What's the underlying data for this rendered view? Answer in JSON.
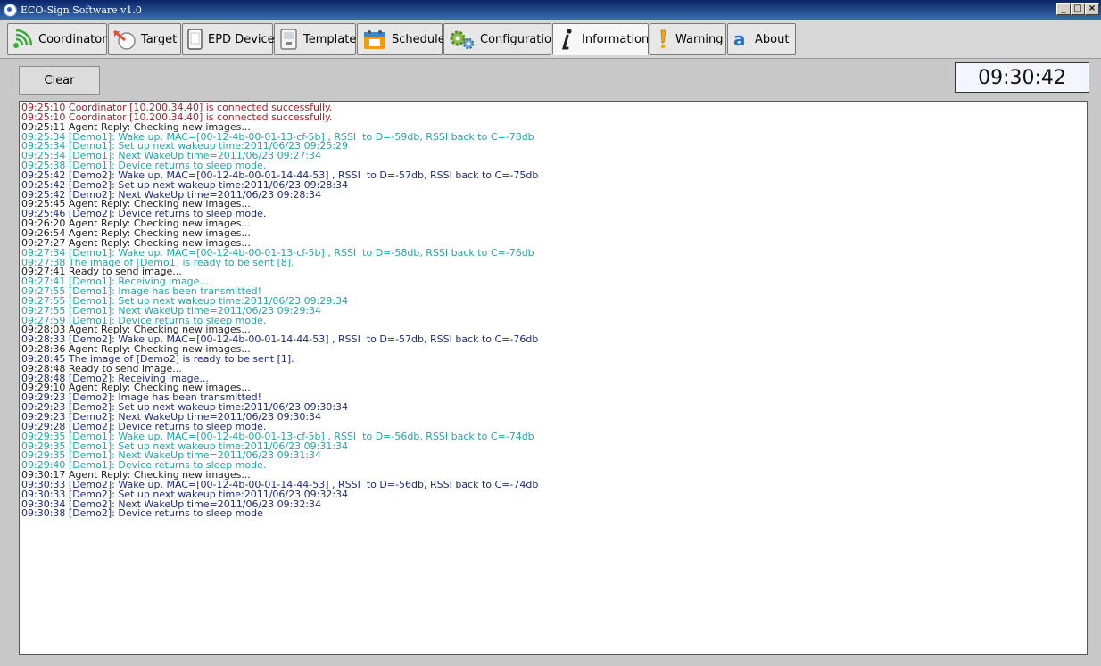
{
  "window": {
    "title": "ECO-Sign Software v1.0",
    "buttons": [
      "_",
      "□",
      "×"
    ]
  },
  "tabs": [
    {
      "label": "Coordinator",
      "icon": "signal-waves-icon"
    },
    {
      "label": "Target",
      "icon": "target-arrow-icon"
    },
    {
      "label": "EPD Device",
      "icon": "device-icon"
    },
    {
      "label": "Template",
      "icon": "template-icon"
    },
    {
      "label": "Schedule",
      "icon": "calendar-icon"
    },
    {
      "label": "Configuration",
      "icon": "gears-icon"
    },
    {
      "label": "Information",
      "icon": "info-icon",
      "active": true
    },
    {
      "label": "Warning",
      "icon": "exclamation-icon"
    },
    {
      "label": "About",
      "icon": "about-a-icon"
    }
  ],
  "toolbar": {
    "clear_label": "Clear",
    "clock": "09:30:42"
  },
  "log": [
    {
      "text": "09:25:10 Coordinator [10.200.34.40] is connected successfully.",
      "color": "red"
    },
    {
      "text": "09:25:10 Coordinator [10.200.34.40] is connected successfully.",
      "color": "red"
    },
    {
      "text": "09:25:11 Agent Reply: Checking new images...",
      "color": "black"
    },
    {
      "text": "09:25:34 [Demo1]: Wake up. MAC=[00-12-4b-00-01-13-cf-5b] , RSSI  to D=-59db, RSSI back to C=-78db",
      "color": "teal"
    },
    {
      "text": "09:25:34 [Demo1]: Set up next wakeup time:2011/06/23 09:25:29",
      "color": "teal"
    },
    {
      "text": "09:25:34 [Demo1]: Next WakeUp time=2011/06/23 09:27:34",
      "color": "teal"
    },
    {
      "text": "09:25:38 [Demo1]: Device returns to sleep mode.",
      "color": "teal"
    },
    {
      "text": "09:25:42 [Demo2]: Wake up. MAC=[00-12-4b-00-01-14-44-53] , RSSI  to D=-57db, RSSI back to C=-75db",
      "color": "navy"
    },
    {
      "text": "09:25:42 [Demo2]: Set up next wakeup time:2011/06/23 09:28:34",
      "color": "navy"
    },
    {
      "text": "09:25:42 [Demo2]: Next WakeUp time=2011/06/23 09:28:34",
      "color": "navy"
    },
    {
      "text": "09:25:45 Agent Reply: Checking new images...",
      "color": "black"
    },
    {
      "text": "09:25:46 [Demo2]: Device returns to sleep mode.",
      "color": "navy"
    },
    {
      "text": "09:26:20 Agent Reply: Checking new images...",
      "color": "black"
    },
    {
      "text": "09:26:54 Agent Reply: Checking new images...",
      "color": "black"
    },
    {
      "text": "09:27:27 Agent Reply: Checking new images...",
      "color": "black"
    },
    {
      "text": "09:27:34 [Demo1]: Wake up. MAC=[00-12-4b-00-01-13-cf-5b] , RSSI  to D=-58db, RSSI back to C=-76db",
      "color": "teal"
    },
    {
      "text": "09:27:38 The image of [Demo1] is ready to be sent [8].",
      "color": "teal"
    },
    {
      "text": "09:27:41 Ready to send image...",
      "color": "black"
    },
    {
      "text": "09:27:41 [Demo1]: Receiving image...",
      "color": "teal"
    },
    {
      "text": "09:27:55 [Demo1]: Image has been transmitted!",
      "color": "teal"
    },
    {
      "text": "09:27:55 [Demo1]: Set up next wakeup time:2011/06/23 09:29:34",
      "color": "teal"
    },
    {
      "text": "09:27:55 [Demo1]: Next WakeUp time=2011/06/23 09:29:34",
      "color": "teal"
    },
    {
      "text": "09:27:59 [Demo1]: Device returns to sleep mode.",
      "color": "teal"
    },
    {
      "text": "09:28:03 Agent Reply: Checking new images...",
      "color": "black"
    },
    {
      "text": "09:28:33 [Demo2]: Wake up. MAC=[00-12-4b-00-01-14-44-53] , RSSI  to D=-57db, RSSI back to C=-76db",
      "color": "navy"
    },
    {
      "text": "09:28:36 Agent Reply: Checking new images...",
      "color": "black"
    },
    {
      "text": "09:28:45 The image of [Demo2] is ready to be sent [1].",
      "color": "navy"
    },
    {
      "text": "09:28:48 Ready to send image...",
      "color": "black"
    },
    {
      "text": "09:28:48 [Demo2]: Receiving image...",
      "color": "navy"
    },
    {
      "text": "09:29:10 Agent Reply: Checking new images...",
      "color": "black"
    },
    {
      "text": "09:29:23 [Demo2]: Image has been transmitted!",
      "color": "navy"
    },
    {
      "text": "09:29:23 [Demo2]: Set up next wakeup time:2011/06/23 09:30:34",
      "color": "navy"
    },
    {
      "text": "09:29:23 [Demo2]: Next WakeUp time=2011/06/23 09:30:34",
      "color": "navy"
    },
    {
      "text": "09:29:28 [Demo2]: Device returns to sleep mode.",
      "color": "navy"
    },
    {
      "text": "09:29:35 [Demo1]: Wake up. MAC=[00-12-4b-00-01-13-cf-5b] , RSSI  to D=-56db, RSSI back to C=-74db",
      "color": "teal"
    },
    {
      "text": "09:29:35 [Demo1]: Set up next wakeup time:2011/06/23 09:31:34",
      "color": "teal"
    },
    {
      "text": "09:29:35 [Demo1]: Next WakeUp time=2011/06/23 09:31:34",
      "color": "teal"
    },
    {
      "text": "09:29:40 [Demo1]: Device returns to sleep mode.",
      "color": "teal"
    },
    {
      "text": "09:30:17 Agent Reply: Checking new images...",
      "color": "black"
    },
    {
      "text": "09:30:33 [Demo2]: Wake up. MAC=[00-12-4b-00-01-14-44-53] , RSSI  to D=-56db, RSSI back to C=-74db",
      "color": "navy"
    },
    {
      "text": "09:30:33 [Demo2]: Set up next wakeup time:2011/06/23 09:32:34",
      "color": "navy"
    },
    {
      "text": "09:30:34 [Demo2]: Next WakeUp time=2011/06/23 09:32:34",
      "color": "navy"
    },
    {
      "text": "09:30:38 [Demo2]: Device returns to sleep mode",
      "color": "navy"
    }
  ],
  "colors": {
    "red": "#a0242c",
    "black": "#1e1e1e",
    "teal": "#27a2a8",
    "navy": "#1f2b7a"
  }
}
